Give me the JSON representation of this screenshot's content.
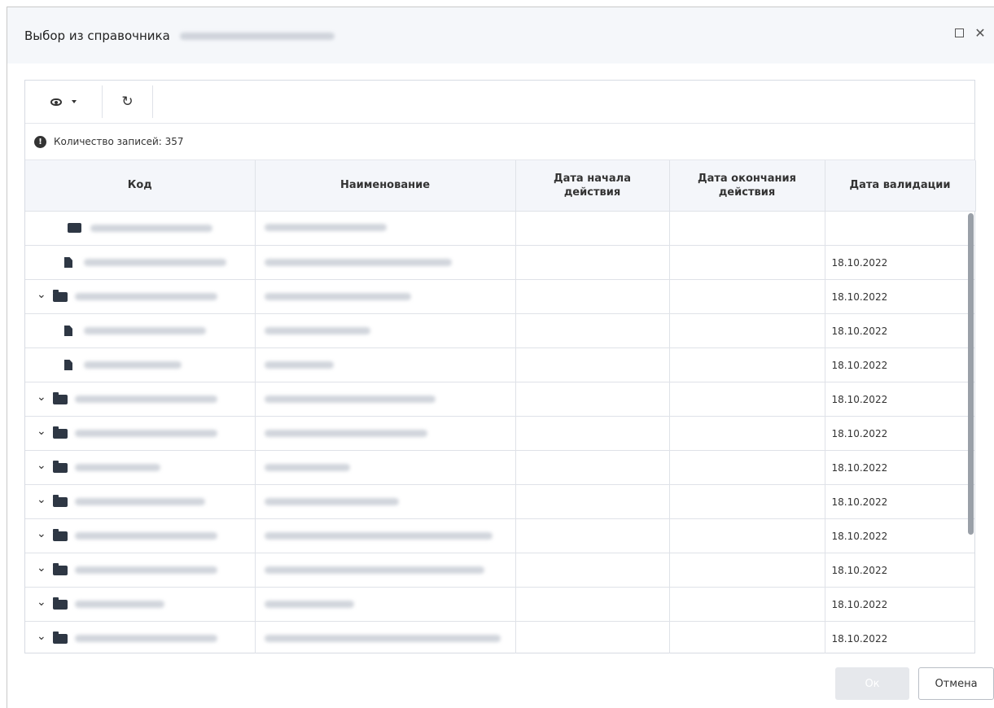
{
  "dialog": {
    "title": "Выбор из справочника"
  },
  "toolbar": {
    "view_icon": "eye-icon",
    "refresh_icon": "refresh-icon"
  },
  "info": {
    "records_text": "Количество записей: 357"
  },
  "table": {
    "columns": [
      "Код",
      "Наименование",
      "Дата начала действия",
      "Дата окончания действия",
      "Дата валидации"
    ],
    "rows": [
      {
        "type": "folder-open",
        "expand": false,
        "date": ""
      },
      {
        "type": "file",
        "expand": false,
        "date": "18.10.2022"
      },
      {
        "type": "folder",
        "expand": true,
        "date": "18.10.2022"
      },
      {
        "type": "file",
        "expand": false,
        "date": "18.10.2022"
      },
      {
        "type": "file",
        "expand": false,
        "date": "18.10.2022"
      },
      {
        "type": "folder",
        "expand": true,
        "date": "18.10.2022"
      },
      {
        "type": "folder",
        "expand": true,
        "date": "18.10.2022"
      },
      {
        "type": "folder",
        "expand": true,
        "date": "18.10.2022"
      },
      {
        "type": "folder",
        "expand": true,
        "date": "18.10.2022"
      },
      {
        "type": "folder",
        "expand": true,
        "date": "18.10.2022"
      },
      {
        "type": "folder",
        "expand": true,
        "date": "18.10.2022"
      },
      {
        "type": "folder",
        "expand": true,
        "date": "18.10.2022"
      },
      {
        "type": "folder",
        "expand": true,
        "date": "18.10.2022"
      }
    ]
  },
  "footer": {
    "ok_label": "Ок",
    "cancel_label": "Отмена"
  }
}
